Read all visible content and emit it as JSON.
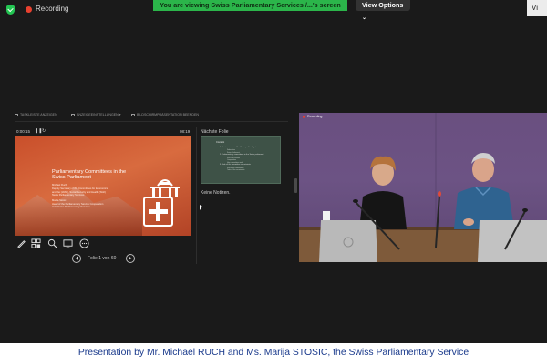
{
  "topbar": {
    "recording_label": "Recording",
    "viewing_banner": "You are viewing Swiss Parliamentary Services /...'s screen",
    "view_options_label": "View Options",
    "right_tab_label": "Vi"
  },
  "presenter": {
    "toolbar": [
      "TASKLEISTE ANZEIGEN",
      "ANZEIGEEINSTELLUNGEN ▾",
      "BILDSCHIRMPRÄSENTATION BEENDEN"
    ],
    "timer": "0:00:15",
    "clock": "08:19",
    "slide": {
      "title": "Parliamentary Committees in the Swiss Parliament",
      "lines": [
        "Michael Ruch",
        "Deputy Secretary of the Committees for Economics",
        "and Tax (WAK), Social Security and Health (SGK)",
        "Swiss Parliamentary Services",
        "",
        "Marija Stosic",
        "Head of the Parliamentary Service Cooperation",
        "Unit, Swiss Parliamentary Services"
      ]
    },
    "tools": [
      "pen-icon",
      "grid-icon",
      "zoom-icon",
      "monitor-icon",
      "more-icon"
    ],
    "nav_label": "Folie 1 von 60",
    "next_slide_label": "Nächste Folie",
    "next_slide": {
      "title": "Content",
      "lines": [
        {
          "text": "1. Basic overview of the Swiss political system",
          "sub": [
            "Federalism",
            "Swiss Parliament"
          ]
        },
        {
          "text": "2. Parliamentary committees in the Swiss parliament",
          "sub": [
            "Role and function",
            "Composition",
            "How committees work"
          ]
        },
        {
          "text": "3. Role of the committee secretariats",
          "sub": [
            "Staff of the committees",
            "Tasks of the secretariats"
          ]
        }
      ]
    },
    "notes": "Keine Notizen."
  },
  "camera": {
    "badge": "Recording"
  },
  "caption": "Presentation by Mr. Michael RUCH and Ms. Marija STOSIC, the Swiss Parliamentary Service",
  "colors": {
    "viewing_banner": "#2bb54a",
    "slide_accent": "#c94f2b",
    "caption_text": "#1a3a8c"
  }
}
